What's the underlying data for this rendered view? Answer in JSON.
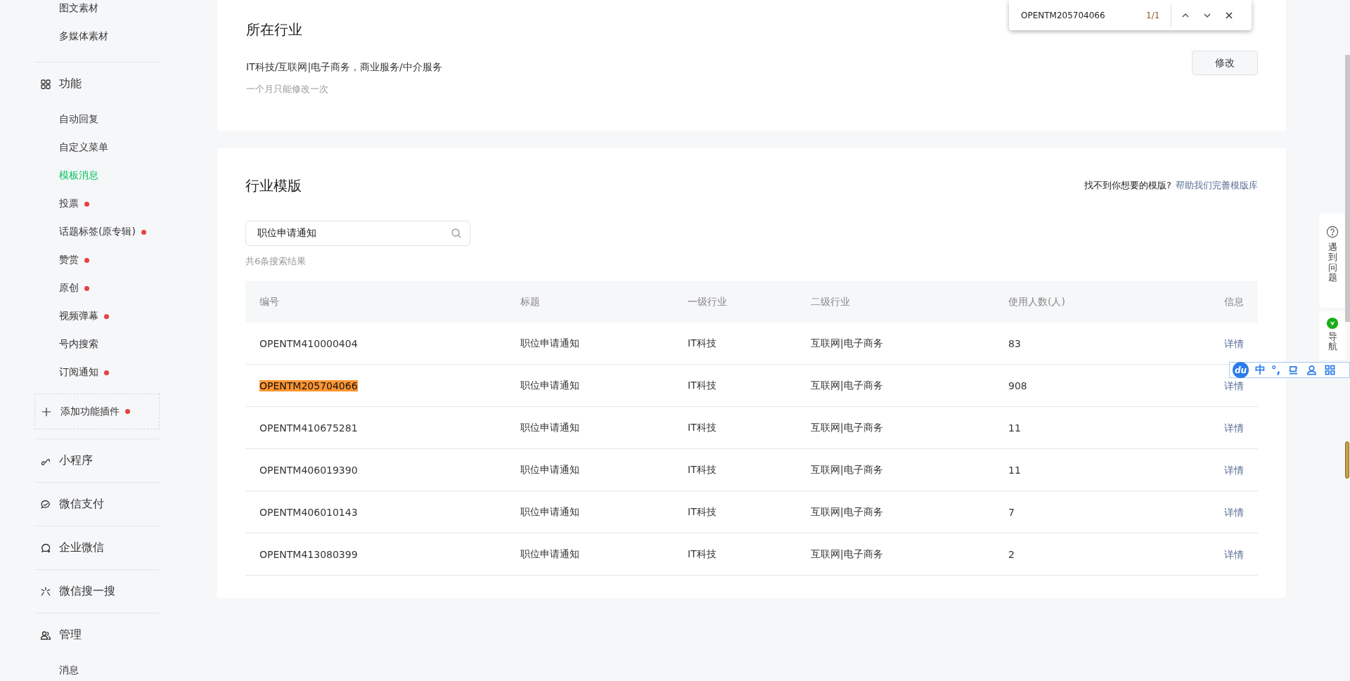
{
  "sidebar": {
    "sections": [
      {
        "items": [
          {
            "label": "图文素材",
            "selected": false,
            "badge_dot": false
          },
          {
            "label": "多媒体素材",
            "selected": false,
            "badge_dot": false
          }
        ]
      },
      {
        "label": "功能",
        "items": [
          {
            "label": "自动回复",
            "selected": false,
            "badge_dot": false
          },
          {
            "label": "自定义菜单",
            "selected": false,
            "badge_dot": false
          },
          {
            "label": "模板消息",
            "selected": true,
            "badge_dot": false
          },
          {
            "label": "投票",
            "selected": false,
            "badge_dot": true
          },
          {
            "label": "话题标签(原专辑)",
            "selected": false,
            "badge_dot": true
          },
          {
            "label": "赞赏",
            "selected": false,
            "badge_dot": true
          },
          {
            "label": "原创",
            "selected": false,
            "badge_dot": true
          },
          {
            "label": "视频弹幕",
            "selected": false,
            "badge_dot": true
          },
          {
            "label": "号内搜索",
            "selected": false,
            "badge_dot": false
          },
          {
            "label": "订阅通知",
            "selected": false,
            "badge_dot": true
          }
        ],
        "add_plugin": {
          "label": "添加功能插件",
          "badge_dot": true
        }
      },
      {
        "label": "小程序"
      },
      {
        "label": "微信支付"
      },
      {
        "label": "企业微信"
      },
      {
        "label": "微信搜一搜"
      },
      {
        "label": "管理",
        "items": [
          {
            "label": "消息",
            "selected": false,
            "badge_dot": false
          }
        ]
      }
    ]
  },
  "industry_card": {
    "title": "所在行业",
    "value": "IT科技/互联网|电子商务，商业服务/中介服务",
    "hint": "一个月只能修改一次",
    "button": "修改"
  },
  "template_card": {
    "title": "行业模版",
    "help_text": "找不到你想要的模版?",
    "help_link": "帮助我们完善模版库",
    "search": {
      "value": "职位申请通知"
    },
    "result_count": "共6条搜索结果",
    "table": {
      "columns": [
        "编号",
        "标题",
        "一级行业",
        "二级行业",
        "使用人数(人)",
        "信息"
      ],
      "rows": [
        {
          "cells": [
            "OPENTM410000404",
            "职位申请通知",
            "IT科技",
            "互联网|电子商务",
            "83",
            "详情"
          ],
          "find_match": false
        },
        {
          "cells": [
            "OPENTM205704066",
            "职位申请通知",
            "IT科技",
            "互联网|电子商务",
            "908",
            "详情"
          ],
          "find_match": true
        },
        {
          "cells": [
            "OPENTM410675281",
            "职位申请通知",
            "IT科技",
            "互联网|电子商务",
            "11",
            "详情"
          ],
          "find_match": false
        },
        {
          "cells": [
            "OPENTM406019390",
            "职位申请通知",
            "IT科技",
            "互联网|电子商务",
            "11",
            "详情"
          ],
          "find_match": false
        },
        {
          "cells": [
            "OPENTM406010143",
            "职位申请通知",
            "IT科技",
            "互联网|电子商务",
            "7",
            "详情"
          ],
          "find_match": false
        },
        {
          "cells": [
            "OPENTM413080399",
            "职位申请通知",
            "IT科技",
            "互联网|电子商务",
            "2",
            "详情"
          ],
          "find_match": false
        }
      ]
    }
  },
  "find_bar": {
    "query": "OPENTM205704066",
    "count": "1/1"
  },
  "side_widgets": [
    {
      "label": "遇到问题"
    },
    {
      "label": "导航"
    }
  ],
  "ime_toolbar": {
    "logo": "du",
    "mode": "中",
    "punctuation": "°,"
  }
}
